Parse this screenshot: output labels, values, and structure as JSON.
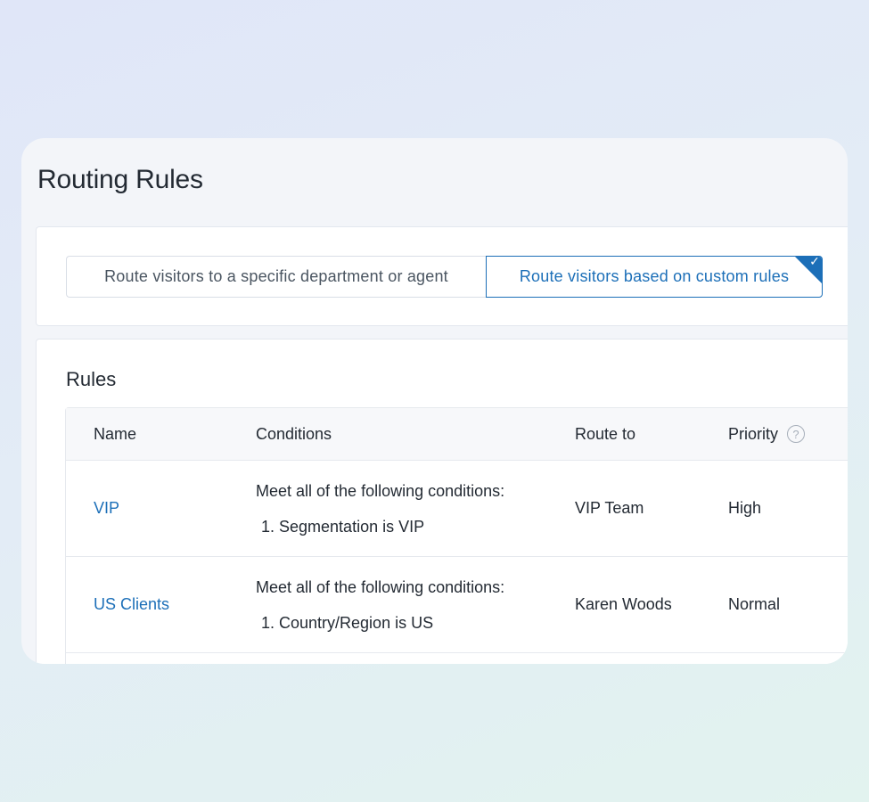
{
  "page": {
    "title": "Routing Rules"
  },
  "mode": {
    "options": [
      {
        "label": "Route visitors to a specific department or agent",
        "selected": false
      },
      {
        "label": "Route visitors based on custom rules",
        "selected": true
      }
    ],
    "accent": "#1c6fb8"
  },
  "rules": {
    "title": "Rules",
    "columns": {
      "name": "Name",
      "conditions": "Conditions",
      "route_to": "Route to",
      "priority": "Priority"
    },
    "help_glyph": "?",
    "rows": [
      {
        "name": "VIP",
        "conditions_lead": "Meet all of the following conditions:",
        "conditions": [
          "1. Segmentation is VIP"
        ],
        "route_to": "VIP Team",
        "priority": "High"
      },
      {
        "name": "US Clients",
        "conditions_lead": "Meet all of the following conditions:",
        "conditions": [
          "1. Country/Region is US"
        ],
        "route_to": "Karen Woods",
        "priority": "Normal"
      }
    ]
  },
  "icons": {
    "selected_check": "check-icon",
    "priority_help": "question-circle-icon"
  }
}
